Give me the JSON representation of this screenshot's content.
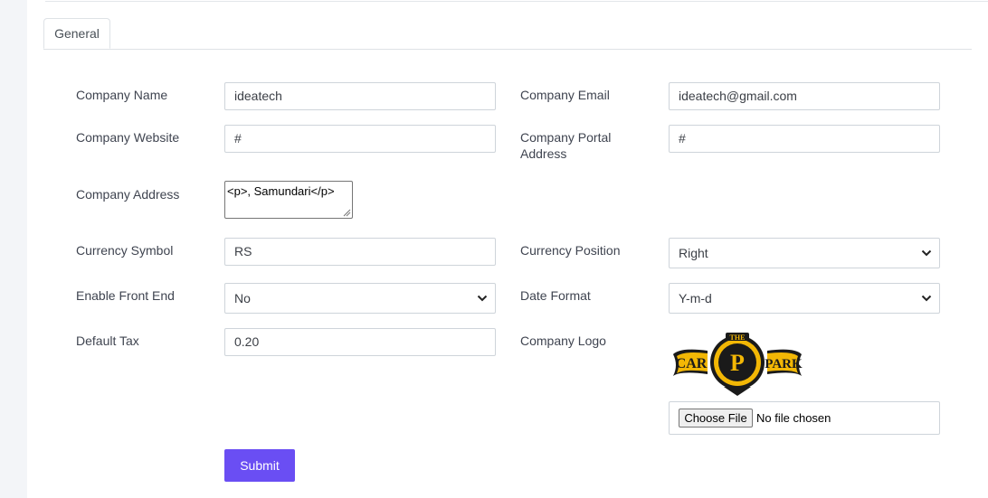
{
  "tabs": [
    {
      "label": "General"
    }
  ],
  "form": {
    "company_name": {
      "label": "Company Name",
      "value": "ideatech"
    },
    "company_email": {
      "label": "Company Email",
      "value": "ideatech@gmail.com"
    },
    "company_website": {
      "label": "Company Website",
      "value": "#"
    },
    "company_portal_address": {
      "label_line1": "Company Portal",
      "label_line2": "Address",
      "value": "#"
    },
    "company_address": {
      "label": "Company Address",
      "value": "<p>, Samundari</p>"
    },
    "currency_symbol": {
      "label": "Currency Symbol",
      "value": "RS"
    },
    "currency_position": {
      "label": "Currency Position",
      "value": "Right"
    },
    "enable_front_end": {
      "label": "Enable Front End",
      "value": "No"
    },
    "date_format": {
      "label": "Date Format",
      "value": "Y-m-d"
    },
    "default_tax": {
      "label": "Default Tax",
      "value": "0.20"
    },
    "company_logo": {
      "label": "Company Logo",
      "logo_text": {
        "left": "CAR",
        "center": "P",
        "right": "PARK",
        "top": "THE"
      },
      "file_button": "Choose File",
      "file_status": "No file chosen"
    },
    "submit_label": "Submit"
  },
  "colors": {
    "accent": "#6a4ef3",
    "logo_gold": "#f2b705",
    "logo_black": "#1a1a1a"
  }
}
